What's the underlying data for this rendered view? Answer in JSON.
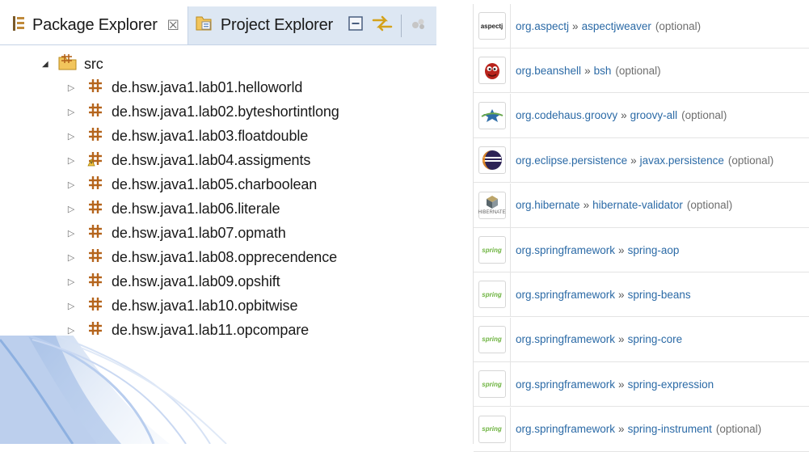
{
  "package_explorer": {
    "tabs": [
      {
        "label": "Package Explorer",
        "close": "☒"
      },
      {
        "label": "Project Explorer"
      }
    ],
    "toolbar_icons": [
      "collapse-all-icon",
      "link-with-editor-icon",
      "view-menu-icon"
    ],
    "root": {
      "label": "src",
      "twisty": "◢"
    },
    "packages": [
      {
        "label": "de.hsw.java1.lab01.helloworld",
        "warning": false
      },
      {
        "label": "de.hsw.java1.lab02.byteshortintlong",
        "warning": false
      },
      {
        "label": "de.hsw.java1.lab03.floatdouble",
        "warning": false
      },
      {
        "label": "de.hsw.java1.lab04.assigments",
        "warning": true
      },
      {
        "label": "de.hsw.java1.lab05.charboolean",
        "warning": false
      },
      {
        "label": "de.hsw.java1.lab06.literale",
        "warning": false
      },
      {
        "label": "de.hsw.java1.lab07.opmath",
        "warning": false
      },
      {
        "label": "de.hsw.java1.lab08.opprecendence",
        "warning": false
      },
      {
        "label": "de.hsw.java1.lab09.opshift",
        "warning": false
      },
      {
        "label": "de.hsw.java1.lab10.opbitwise",
        "warning": false
      },
      {
        "label": "de.hsw.java1.lab11.opcompare",
        "warning": false
      }
    ],
    "twisty_closed": "▷"
  },
  "dependencies": {
    "separator": "»",
    "items": [
      {
        "group": "org.aspectj",
        "artifact": "aspectjweaver",
        "optional": "(optional)",
        "logo": "aspectj-logo",
        "logo_text": "aspectj"
      },
      {
        "group": "org.beanshell",
        "artifact": "bsh",
        "optional": "(optional)",
        "logo": "beanshell-logo"
      },
      {
        "group": "org.codehaus.groovy",
        "artifact": "groovy-all",
        "optional": "(optional)",
        "logo": "groovy-logo"
      },
      {
        "group": "org.eclipse.persistence",
        "artifact": "javax.persistence",
        "optional": "(optional)",
        "logo": "eclipse-logo"
      },
      {
        "group": "org.hibernate",
        "artifact": "hibernate-validator",
        "optional": "(optional)",
        "logo": "hibernate-logo",
        "logo_text": "HIBERNATE"
      },
      {
        "group": "org.springframework",
        "artifact": "spring-aop",
        "optional": "",
        "logo": "spring-logo",
        "logo_text": "spring"
      },
      {
        "group": "org.springframework",
        "artifact": "spring-beans",
        "optional": "",
        "logo": "spring-logo",
        "logo_text": "spring"
      },
      {
        "group": "org.springframework",
        "artifact": "spring-core",
        "optional": "",
        "logo": "spring-logo",
        "logo_text": "spring"
      },
      {
        "group": "org.springframework",
        "artifact": "spring-expression",
        "optional": "",
        "logo": "spring-logo",
        "logo_text": "spring"
      },
      {
        "group": "org.springframework",
        "artifact": "spring-instrument",
        "optional": "(optional)",
        "logo": "spring-logo",
        "logo_text": "spring"
      }
    ]
  },
  "colors": {
    "link": "#2b6aa6",
    "optional": "#6e6e6e",
    "package_brown": "#b5651d",
    "spring_green": "#6db33f"
  }
}
